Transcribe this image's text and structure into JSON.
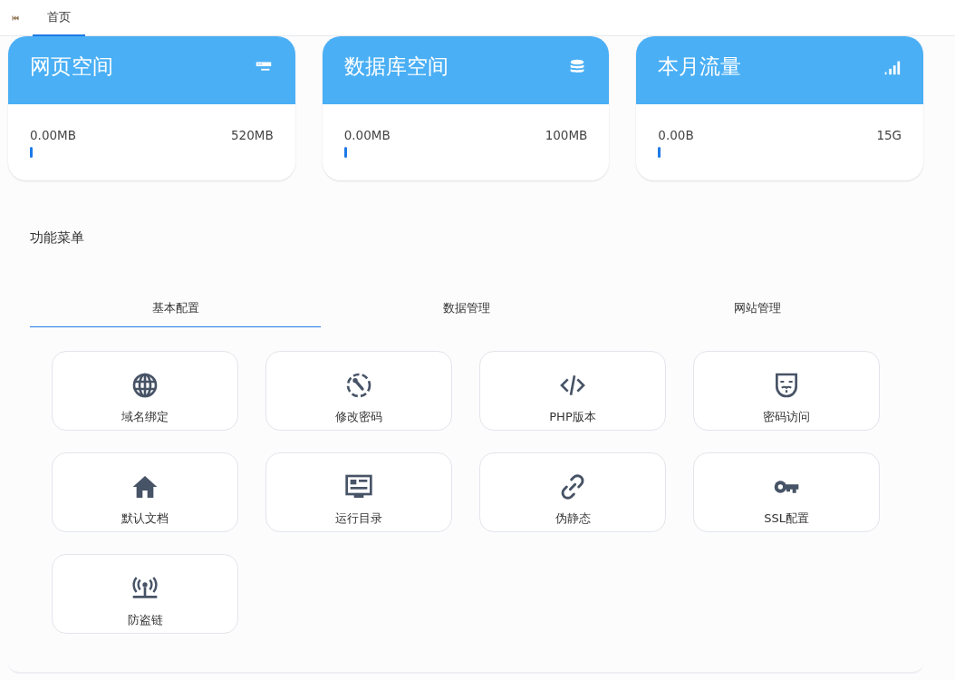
{
  "nav_tabs": [
    {
      "label": "首页",
      "selected": true
    }
  ],
  "stats": [
    {
      "title": "网页空间",
      "used": "0.00MB",
      "total": "520MB",
      "level": 0
    },
    {
      "title": "数据库空间",
      "used": "0.00MB",
      "total": "100MB",
      "level": 0
    },
    {
      "title": "本月流量",
      "used": "0.00B",
      "total": "15G",
      "level": 0
    }
  ],
  "menu": {
    "title": "功能菜单",
    "tabs": [
      {
        "label": "基本配置",
        "selected": true
      },
      {
        "label": "数据管理",
        "selected": false
      },
      {
        "label": "网站管理",
        "selected": false
      }
    ],
    "items": [
      {
        "label": "域名绑定"
      },
      {
        "label": "修改密码"
      },
      {
        "label": "PHP版本"
      },
      {
        "label": "密码访问"
      },
      {
        "label": "默认文档"
      },
      {
        "label": "运行目录"
      },
      {
        "label": "伪静态"
      },
      {
        "label": "SSL配置"
      },
      {
        "label": "防盗链"
      }
    ]
  }
}
